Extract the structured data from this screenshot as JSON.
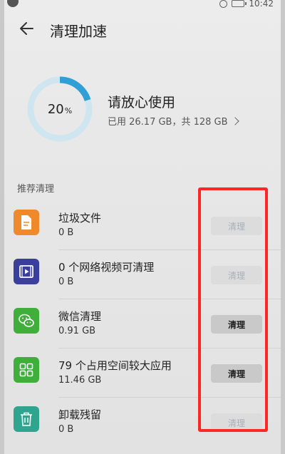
{
  "status_bar": {
    "time": "10:42"
  },
  "header": {
    "title": "清理加速"
  },
  "storage": {
    "percent_value": "20",
    "percent_sign": "%",
    "used_fraction": 0.2,
    "headline": "请放心使用",
    "detail": "已用 26.17 GB，共 128 GB",
    "ring_color": "#2f9fd6",
    "ring_track_color": "#cfe6f1"
  },
  "section": {
    "label": "推荐清理"
  },
  "items": [
    {
      "title": "垃圾文件",
      "size": "0 B",
      "button": "清理",
      "button_enabled": false,
      "icon": "document-icon",
      "icon_color": "#ee8a2c"
    },
    {
      "title": "0 个网络视频可清理",
      "size": "0 B",
      "button": "清理",
      "button_enabled": false,
      "icon": "video-icon",
      "icon_color": "#3a3f9e"
    },
    {
      "title": "微信清理",
      "size": "0.91 GB",
      "button": "清理",
      "button_enabled": true,
      "icon": "wechat-icon",
      "icon_color": "#3fae3a"
    },
    {
      "title": "79 个占用空间较大应用",
      "size": "11.46 GB",
      "button": "清理",
      "button_enabled": true,
      "icon": "apps-grid-icon",
      "icon_color": "#3fae3a"
    },
    {
      "title": "卸载残留",
      "size": "0 B",
      "button": "清理",
      "button_enabled": false,
      "icon": "trash-icon",
      "icon_color": "#2fa58f"
    }
  ],
  "annotation": {
    "highlight_color": "#ff2626"
  }
}
